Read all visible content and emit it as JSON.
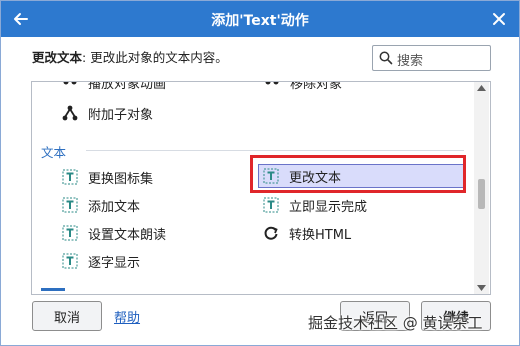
{
  "window": {
    "title": "添加'Text'动作",
    "back_icon": "arrow-left-icon",
    "close_icon": "close-icon"
  },
  "description": {
    "label": "更改文本",
    "text": ": 更改此对象的文本内容。"
  },
  "search": {
    "placeholder": "搜索",
    "icon": "search-icon"
  },
  "list": {
    "clipped_top": [
      "播放对象动画",
      "移除对象"
    ],
    "top_item": "附加子对象",
    "section_title": "文本",
    "left_items": [
      "更换图标集",
      "添加文本",
      "设置文本朗读",
      "逐字显示"
    ],
    "right_items": [
      "更改文本",
      "立即显示完成",
      "转换HTML"
    ],
    "selected_item": "更改文本"
  },
  "buttons": {
    "cancel": "取消",
    "help": "帮助",
    "back": "返回",
    "continue": "继续"
  },
  "watermark": "掘金技术社区 @ 黄误杂工",
  "colors": {
    "titlebar": "#2d79cf",
    "accent_text": "#2d6fc0",
    "selection_bg": "#d9dcfb",
    "highlight_border": "#e0262a",
    "icon_teal": "#2a8a86"
  }
}
